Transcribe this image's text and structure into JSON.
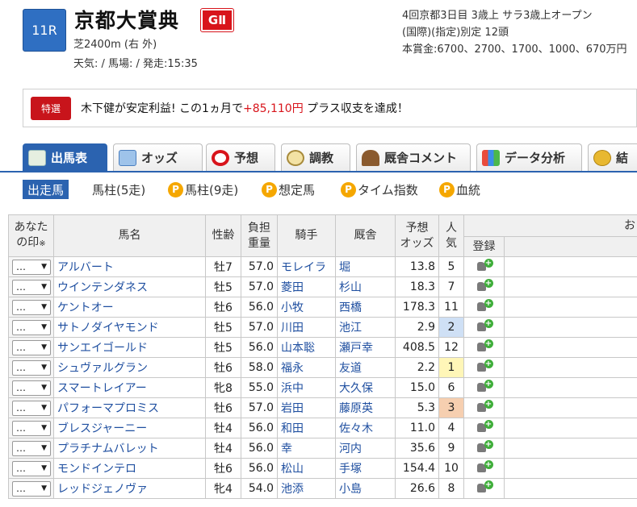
{
  "race": {
    "number": "11R",
    "title": "京都大賞典",
    "grade": "GⅡ",
    "course": "芝2400m (右 外)",
    "weather_line": "天気: / 馬場: / 発走:15:35",
    "info_lines": [
      "4回京都3日目 3歳上 サラ3歳上オープン",
      "(国際)(指定)別定 12頭",
      "本賞金:6700、2700、1700、1000、670万円"
    ]
  },
  "promo": {
    "badge": "特選",
    "text_before": "木下健が安定利益! この1ヵ月で",
    "amount": "+85,110円",
    "text_after": " プラス収支を達成！"
  },
  "main_tabs": [
    {
      "label": "出馬表",
      "icon": "entry-table-icon",
      "active": true
    },
    {
      "label": "オッズ",
      "icon": "odds-icon",
      "active": false
    },
    {
      "label": "予想",
      "icon": "target-icon",
      "active": false
    },
    {
      "label": "調教",
      "icon": "stopwatch-icon",
      "active": false
    },
    {
      "label": "厩舎コメント",
      "icon": "stable-icon",
      "active": false
    },
    {
      "label": "データ分析",
      "icon": "bar-chart-icon",
      "active": false
    },
    {
      "label": "結",
      "icon": "coins-icon",
      "active": false
    }
  ],
  "sub_tabs": [
    {
      "label": "出走馬",
      "premium": false,
      "active": true
    },
    {
      "label": "馬柱(5走)",
      "premium": false,
      "active": false
    },
    {
      "label": "馬柱(9走)",
      "premium": true,
      "active": false
    },
    {
      "label": "想定馬",
      "premium": true,
      "active": false
    },
    {
      "label": "タイム指数",
      "premium": true,
      "active": false
    },
    {
      "label": "血統",
      "premium": true,
      "active": false
    }
  ],
  "premium_mark": "P",
  "table": {
    "headers": {
      "mark_line1": "あなた",
      "mark_line2": "の印",
      "mark_note": "※",
      "name": "馬名",
      "sex_age": "性齢",
      "weight_line1": "負担",
      "weight_line2": "重量",
      "jockey": "騎手",
      "trainer": "厩舎",
      "odds_line1": "予想",
      "odds_line2": "オッズ",
      "pop_line1": "人",
      "pop_line2": "気",
      "extra": "お",
      "register": "登録"
    },
    "select_value": "…",
    "select_arrow": "▼",
    "rows": [
      {
        "name": "アルバート",
        "sex_age": "牡7",
        "weight": "57.0",
        "jockey": "モレイラ",
        "trainer": "堀",
        "odds": "13.8",
        "pop": "5"
      },
      {
        "name": "ウインテンダネス",
        "sex_age": "牡5",
        "weight": "57.0",
        "jockey": "菱田",
        "trainer": "杉山",
        "odds": "18.3",
        "pop": "7"
      },
      {
        "name": "ケントオー",
        "sex_age": "牡6",
        "weight": "56.0",
        "jockey": "小牧",
        "trainer": "西橋",
        "odds": "178.3",
        "pop": "11"
      },
      {
        "name": "サトノダイヤモンド",
        "sex_age": "牡5",
        "weight": "57.0",
        "jockey": "川田",
        "trainer": "池江",
        "odds": "2.9",
        "pop": "2"
      },
      {
        "name": "サンエイゴールド",
        "sex_age": "牡5",
        "weight": "56.0",
        "jockey": "山本聡",
        "trainer": "瀬戸幸",
        "odds": "408.5",
        "pop": "12"
      },
      {
        "name": "シュヴァルグラン",
        "sex_age": "牡6",
        "weight": "58.0",
        "jockey": "福永",
        "trainer": "友道",
        "odds": "2.2",
        "pop": "1"
      },
      {
        "name": "スマートレイアー",
        "sex_age": "牝8",
        "weight": "55.0",
        "jockey": "浜中",
        "trainer": "大久保",
        "odds": "15.0",
        "pop": "6"
      },
      {
        "name": "パフォーマプロミス",
        "sex_age": "牡6",
        "weight": "57.0",
        "jockey": "岩田",
        "trainer": "藤原英",
        "odds": "5.3",
        "pop": "3"
      },
      {
        "name": "ブレスジャーニー",
        "sex_age": "牡4",
        "weight": "56.0",
        "jockey": "和田",
        "trainer": "佐々木",
        "odds": "11.0",
        "pop": "4"
      },
      {
        "name": "プラチナムバレット",
        "sex_age": "牡4",
        "weight": "56.0",
        "jockey": "幸",
        "trainer": "河内",
        "odds": "35.6",
        "pop": "9"
      },
      {
        "name": "モンドインテロ",
        "sex_age": "牡6",
        "weight": "56.0",
        "jockey": "松山",
        "trainer": "手塚",
        "odds": "154.4",
        "pop": "10"
      },
      {
        "name": "レッドジェノヴァ",
        "sex_age": "牝4",
        "weight": "54.0",
        "jockey": "池添",
        "trainer": "小島",
        "odds": "26.6",
        "pop": "8"
      }
    ]
  },
  "colors": {
    "accent": "#2b63b0",
    "grade_red": "#d8141b",
    "pop1": "#fff6b8",
    "pop2": "#cfe0f5",
    "pop3": "#f6cfb0"
  }
}
